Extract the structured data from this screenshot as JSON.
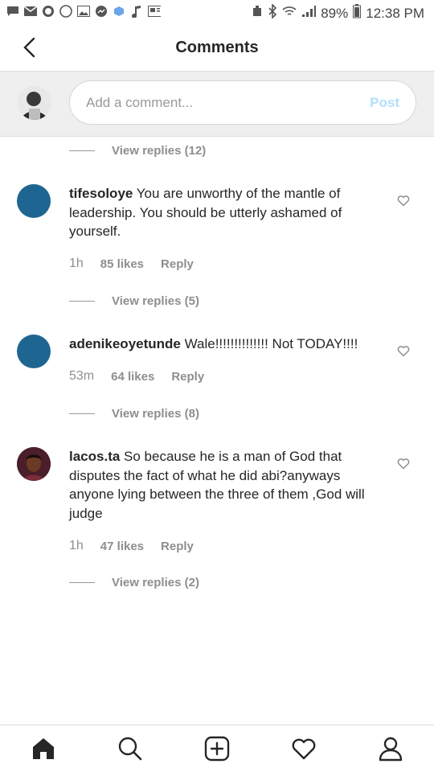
{
  "status_bar": {
    "battery": "89%",
    "time": "12:38 PM"
  },
  "header": {
    "title": "Comments"
  },
  "composer": {
    "placeholder": "Add a comment...",
    "post_label": "Post"
  },
  "top_view_replies": "View replies (12)",
  "comments": [
    {
      "username": "tifesoloye",
      "text": " You are unworthy of the mantle of leadership. You should be utterly ashamed of yourself.",
      "time": "1h",
      "likes": "85 likes",
      "reply": "Reply",
      "view_replies": "View replies (5)"
    },
    {
      "username": "adenikeoyetunde",
      "text": " Wale!!!!!!!!!!!!!! Not TODAY!!!!",
      "time": "53m",
      "likes": "64 likes",
      "reply": "Reply",
      "view_replies": "View replies (8)"
    },
    {
      "username": "lacos.ta",
      "text": " So because he is a man of God that disputes the fact of what he did abi?anyways anyone lying between the three of them ,God will judge",
      "time": "1h",
      "likes": "47 likes",
      "reply": "Reply",
      "view_replies": "View replies (2)"
    }
  ],
  "colors": {
    "accent": "#b2dffc",
    "avatar_blue": "#1f6592",
    "secondary_text": "#8e8e8e"
  },
  "bottom_nav": [
    "home-icon",
    "search-icon",
    "add-post-icon",
    "activity-heart-icon",
    "profile-icon"
  ]
}
